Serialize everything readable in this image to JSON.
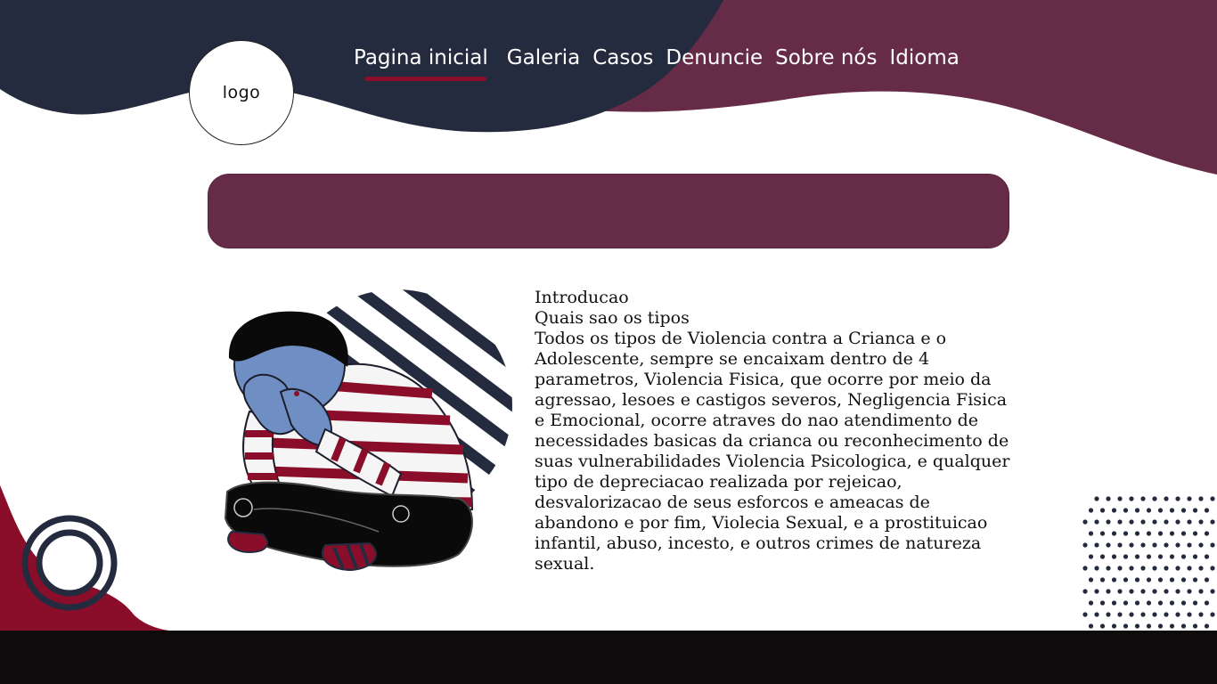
{
  "logo": {
    "label": "logo"
  },
  "nav": {
    "items": [
      {
        "label": "Pagina inicial",
        "active": true
      },
      {
        "label": "Galeria"
      },
      {
        "label": "Casos"
      },
      {
        "label": "Denuncie"
      },
      {
        "label": "Sobre nós"
      },
      {
        "label": "Idioma"
      }
    ]
  },
  "content": {
    "heading": "Introducao",
    "subheading": "Quais sao os tipos",
    "body": "Todos os tipos de Violencia contra a Crianca e o Adolescente, sempre se encaixam dentro de 4 parametros, Violencia Fisica, que ocorre por meio da agressao, lesoes e castigos severos, Negligencia Fisica e Emocional, ocorre atraves do nao atendimento de necessidades basicas da crianca ou reconhecimento de suas vulnerabilidades Violencia Psicologica, e qualquer tipo de depreciacao realizada por rejeicao, desvalorizacao de seus esforcos e ameacas de abandono e por fim, Violecia Sexual, e a prostituicao infantil, abuso, incesto, e outros crimes de natureza sexual."
  },
  "colors": {
    "navy": "#252b3e",
    "plum": "#652b47",
    "crimson": "#8a0e2a",
    "footer": "#0e0b0c",
    "skin": "#6f8fc4"
  }
}
